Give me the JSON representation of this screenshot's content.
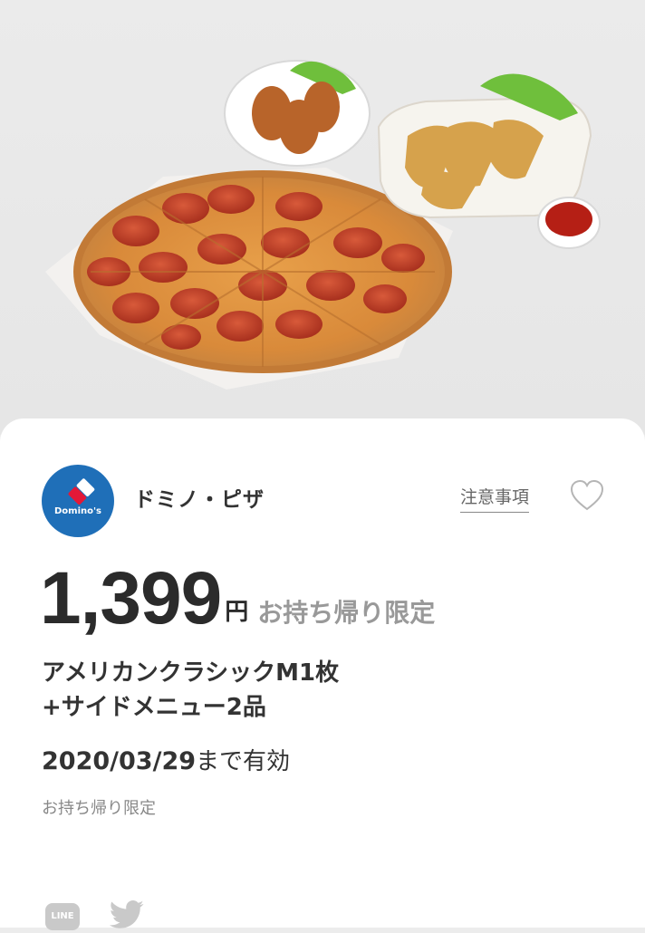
{
  "brand": {
    "name": "ドミノ・ピザ",
    "logo_text": "Domino's",
    "colors": {
      "logo_bg": "#1f6fb8",
      "logo_red": "#e31837"
    }
  },
  "header": {
    "notes_label": "注意事項",
    "favorite_icon": "heart-icon"
  },
  "coupon": {
    "price": "1,399",
    "currency": "円",
    "price_note": "お持ち帰り限定",
    "title_line1": "アメリカンクラシックM1枚",
    "title_line2": "+サイドメニュー2品",
    "valid_date": "2020/03/29",
    "valid_suffix": "まで有効",
    "subnote": "お持ち帰り限定"
  },
  "share": {
    "line_label": "LINE",
    "twitter_icon": "twitter-icon"
  }
}
